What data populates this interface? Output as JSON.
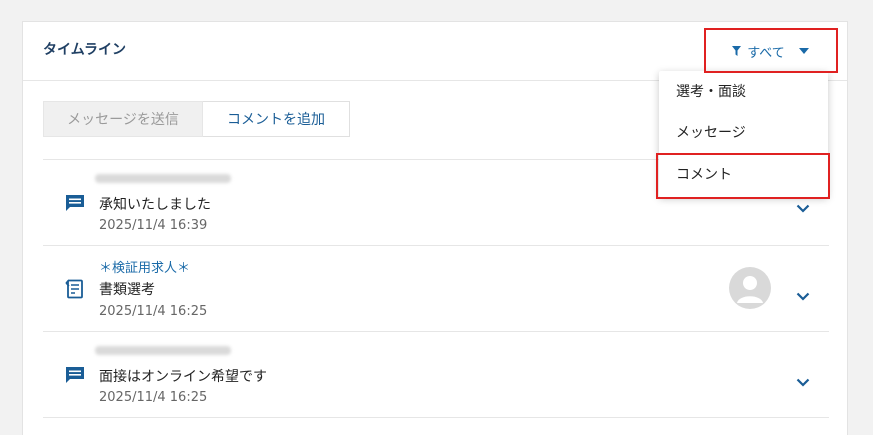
{
  "timeline": {
    "title": "タイムライン",
    "filter": {
      "label": "すべて"
    },
    "tabs": {
      "send_message": "メッセージを送信",
      "add_comment": "コメントを追加"
    },
    "items": [
      {
        "type": "comment",
        "message": "承知いたしました",
        "timestamp": "2025/11/4 16:39"
      },
      {
        "type": "selection",
        "job_title": "＊検証用求人＊",
        "message": "書類選考",
        "timestamp": "2025/11/4 16:25"
      },
      {
        "type": "comment",
        "message": "面接はオンライン希望です",
        "timestamp": "2025/11/4 16:25"
      }
    ]
  },
  "dropdown": {
    "options": [
      "選考・面談",
      "メッセージ",
      "コメント"
    ]
  },
  "colors": {
    "accent": "#1a6aa8",
    "highlight": "#e02121",
    "title": "#1f3f63"
  }
}
